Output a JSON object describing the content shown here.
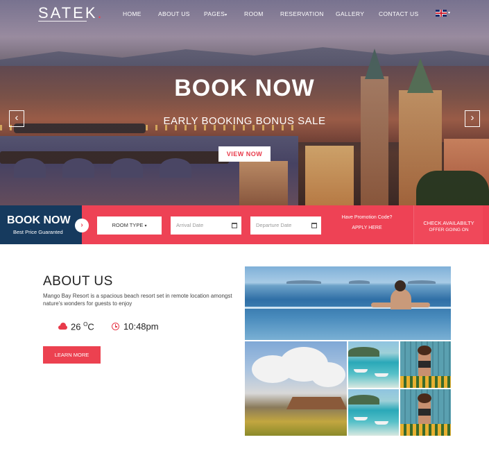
{
  "brand": {
    "logo_text": "SATEK",
    "logo_dot": ".",
    "accent_color": "#ee4255",
    "navy_color": "#163a5e"
  },
  "nav": {
    "items": [
      "HOME",
      "ABOUT US",
      "PAGES",
      "ROOM",
      "RESERVATION",
      "GALLERY",
      "CONTACT US"
    ],
    "pages_caret": "▾",
    "language_icon": "uk-flag-icon"
  },
  "hero": {
    "title": "BOOK NOW",
    "subtitle": "EARLY BOOKING BONUS SALE",
    "cta": "VIEW NOW",
    "prev_arrow": "‹",
    "next_arrow": "›"
  },
  "booking": {
    "title": "BOOK NOW",
    "subtitle": "Best Price Guaranted",
    "go_arrow": "›",
    "room_type": "ROOM TYPE",
    "room_caret": "▾",
    "arrival_placeholder": "Arrival Date",
    "departure_placeholder": "Departure Date",
    "promo_question": "Have Promotion Code?",
    "promo_action": "APPLY HERE",
    "check_title": "CHECK AVAILABILTY",
    "check_sub": "OFFER GOING ON"
  },
  "about": {
    "title": "ABOUT US",
    "description": "Mango Bay Resort is a spacious beach resort set in remote location amongst nature's wonders for guests to enjoy",
    "temperature": "26",
    "temp_unit_sup": "O",
    "temp_unit": "C",
    "time": "10:48pm",
    "learn_more": "LEARN MORE"
  }
}
